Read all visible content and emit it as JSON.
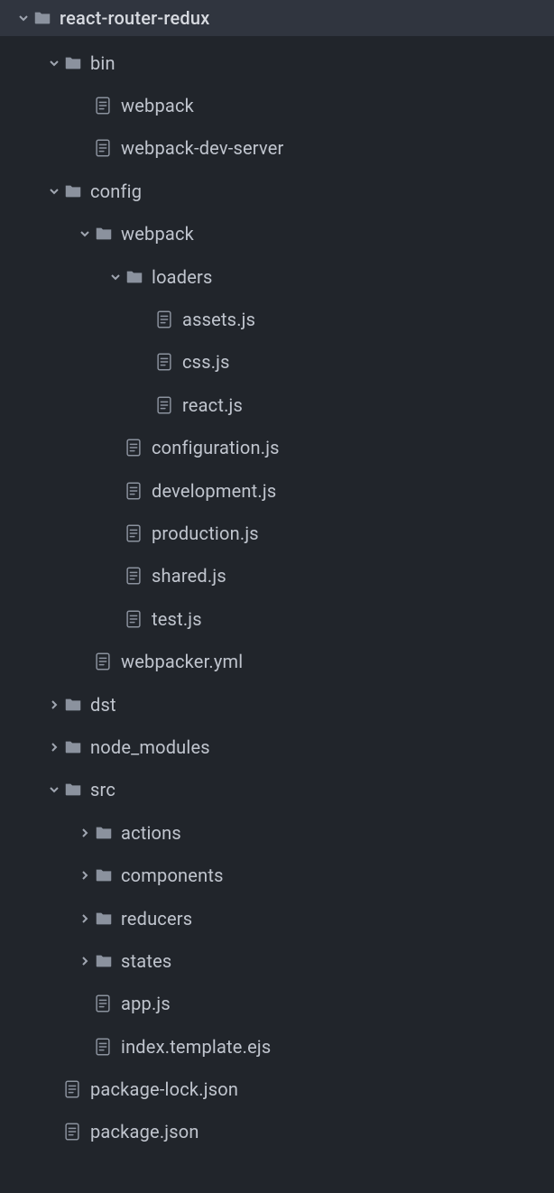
{
  "root": {
    "name": "react-router-redux"
  },
  "items": [
    {
      "type": "folder",
      "depth": 1,
      "expanded": true,
      "label": "bin"
    },
    {
      "type": "file",
      "depth": 2,
      "label": "webpack"
    },
    {
      "type": "file",
      "depth": 2,
      "label": "webpack-dev-server"
    },
    {
      "type": "folder",
      "depth": 1,
      "expanded": true,
      "label": "config"
    },
    {
      "type": "folder",
      "depth": 2,
      "expanded": true,
      "label": "webpack"
    },
    {
      "type": "folder",
      "depth": 3,
      "expanded": true,
      "label": "loaders"
    },
    {
      "type": "file",
      "depth": 4,
      "label": "assets.js"
    },
    {
      "type": "file",
      "depth": 4,
      "label": "css.js"
    },
    {
      "type": "file",
      "depth": 4,
      "label": "react.js"
    },
    {
      "type": "file",
      "depth": 3,
      "label": "configuration.js"
    },
    {
      "type": "file",
      "depth": 3,
      "label": "development.js"
    },
    {
      "type": "file",
      "depth": 3,
      "label": "production.js"
    },
    {
      "type": "file",
      "depth": 3,
      "label": "shared.js"
    },
    {
      "type": "file",
      "depth": 3,
      "label": "test.js"
    },
    {
      "type": "file",
      "depth": 2,
      "label": "webpacker.yml"
    },
    {
      "type": "folder",
      "depth": 1,
      "expanded": false,
      "label": "dst"
    },
    {
      "type": "folder",
      "depth": 1,
      "expanded": false,
      "label": "node_modules"
    },
    {
      "type": "folder",
      "depth": 1,
      "expanded": true,
      "label": "src"
    },
    {
      "type": "folder",
      "depth": 2,
      "expanded": false,
      "label": "actions"
    },
    {
      "type": "folder",
      "depth": 2,
      "expanded": false,
      "label": "components"
    },
    {
      "type": "folder",
      "depth": 2,
      "expanded": false,
      "label": "reducers"
    },
    {
      "type": "folder",
      "depth": 2,
      "expanded": false,
      "label": "states"
    },
    {
      "type": "file",
      "depth": 2,
      "label": "app.js"
    },
    {
      "type": "file",
      "depth": 2,
      "label": "index.template.ejs"
    },
    {
      "type": "file",
      "depth": 1,
      "label": "package-lock.json"
    },
    {
      "type": "file",
      "depth": 1,
      "label": "package.json"
    }
  ],
  "colors": {
    "background": "#21252b",
    "root_background": "#30353f",
    "text": "#c0c5ce",
    "icon": "#8b929e"
  }
}
